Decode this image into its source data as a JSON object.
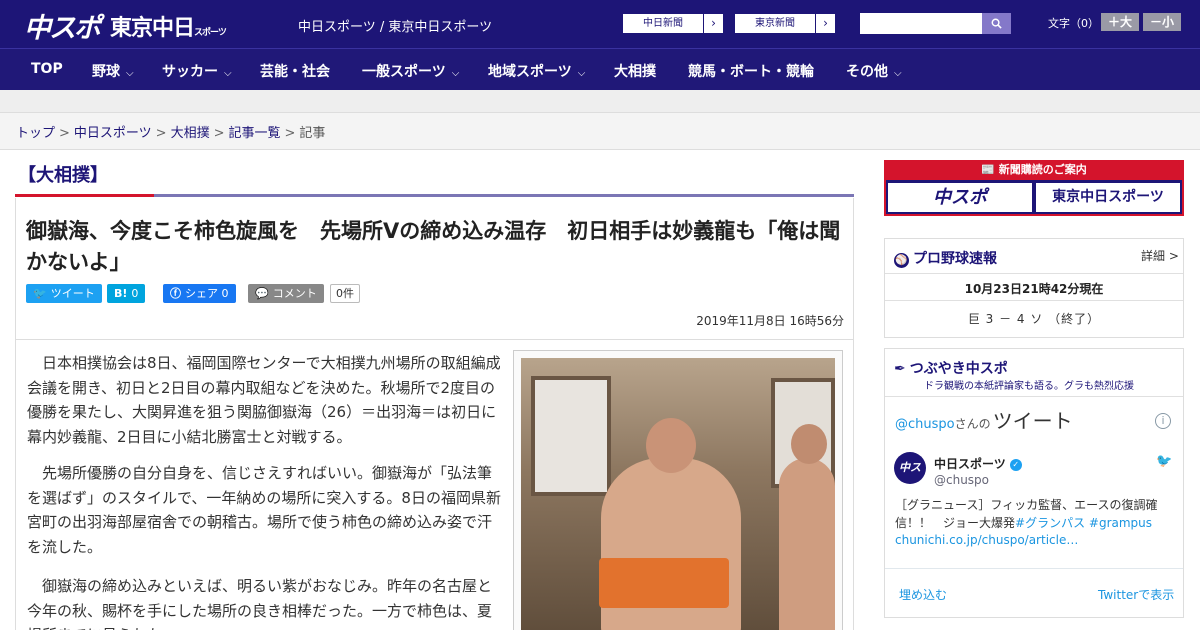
{
  "header": {
    "logo_main": "中スポ",
    "logo_tokyo": "東京中日",
    "logo_tokyo_small": "スポーツ",
    "site_title": "中日スポーツ / 東京中日スポーツ",
    "link_chunichi": "中日新聞",
    "link_tokyo": "東京新聞",
    "search_icon": "search-icon",
    "font_size_label": "文字（0）",
    "font_bigger": "＋大",
    "font_smaller": "－小"
  },
  "nav": {
    "items": [
      {
        "label": "TOP",
        "chevron": false
      },
      {
        "label": "野球",
        "chevron": true
      },
      {
        "label": "サッカー",
        "chevron": true
      },
      {
        "label": "芸能・社会",
        "chevron": false
      },
      {
        "label": "一般スポーツ",
        "chevron": true
      },
      {
        "label": "地域スポーツ",
        "chevron": true
      },
      {
        "label": "大相撲",
        "chevron": false
      },
      {
        "label": "競馬・ボート・競輪",
        "chevron": false
      },
      {
        "label": "その他",
        "chevron": true
      }
    ]
  },
  "breadcrumb": {
    "items": [
      "トップ",
      "中日スポーツ",
      "大相撲",
      "記事一覧"
    ],
    "current": "記事",
    "separator": ">"
  },
  "article": {
    "category": "【大相撲】",
    "headline": "御嶽海、今度こそ柿色旋風を　先場所Vの締め込み温存　初日相手は妙義龍も「俺は聞かないよ」",
    "share": {
      "tweet": "ツイート",
      "hatena_icon": "B!",
      "hatena_count": "0",
      "facebook": "シェア 0",
      "comment": "コメント",
      "comment_count": "0件"
    },
    "date": "2019年11月8日 16時56分",
    "paragraphs": [
      "日本相撲協会は8日、福岡国際センターで大相撲九州場所の取組編成会議を開き、初日と2日目の幕内取組などを決めた。秋場所で2度目の優勝を果たし、大関昇進を狙う関脇御嶽海（26）＝出羽海＝は初日に幕内妙義龍、2日目に小結北勝富士と対戦する。",
      "先場所優勝の自分自身を、信じさえすればいい。御嶽海が「弘法筆を選ばず」のスタイルで、一年納めの場所に突入する。8日の福岡県新宮町の出羽海部屋宿舎での朝稽古。場所で使う柿色の締め込み姿で汗を流した。",
      "御嶽海の締め込みといえば、明るい紫がおなじみ。昨年の名古屋と今年の秋、賜杯を手にした場所の良き相棒だった。一方で柿色は、夏場所までに見られた"
    ]
  },
  "sidebar": {
    "subscribe": {
      "header": "新聞購読のご案内",
      "logo_main": "中スポ",
      "logo_tokyo": "東京中日スポーツ"
    },
    "baseball": {
      "title": "プロ野球速報",
      "detail": "詳細 >",
      "as_of": "10月23日21時42分現在",
      "score": "巨 3 － 4 ソ （終了）"
    },
    "tweets": {
      "title": "つぶやき中スポ",
      "subtitle": "ドラ観戦の本紙評論家も語る。グラも熱烈応援",
      "handle": "@chuspo",
      "handle_suffix": "さんの",
      "handle_label": "ツイート",
      "avatar_text": "中ス",
      "name": "中日スポーツ",
      "screen_name": "@chuspo",
      "text_main": "［グラニュース］フィッカ監督、エースの復調確信！！　ジョー大爆発",
      "hashtag1": "#グランパス",
      "hashtag2": "#grampus",
      "link": "chunichi.co.jp/chuspo/article…",
      "embed": "埋め込む",
      "view_on_twitter": "Twitterで表示"
    }
  }
}
